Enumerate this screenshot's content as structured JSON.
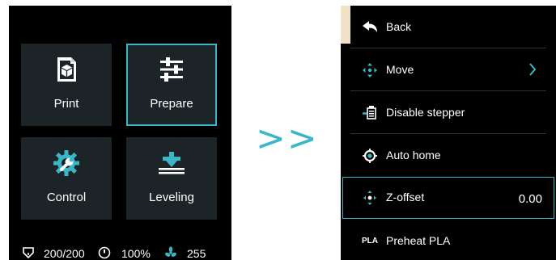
{
  "main_menu": {
    "tiles": [
      {
        "label": "Print",
        "icon": "print-icon"
      },
      {
        "label": "Prepare",
        "icon": "prepare-sliders-icon",
        "selected": true
      },
      {
        "label": "Control",
        "icon": "control-gear-wrench-icon"
      },
      {
        "label": "Leveling",
        "icon": "leveling-icon"
      }
    ],
    "status": {
      "temperature": "200/200",
      "speed": "100%",
      "fan": "255"
    }
  },
  "transition": {
    "arrows": ">>"
  },
  "prepare_menu": {
    "items": [
      {
        "label": "Back",
        "icon": "back-arrow-icon"
      },
      {
        "label": "Move",
        "icon": "move-arrows-icon",
        "has_submenu": true
      },
      {
        "label": "Disable stepper",
        "icon": "stepper-icon"
      },
      {
        "label": "Auto home",
        "icon": "home-target-icon"
      },
      {
        "label": "Z-offset",
        "icon": "z-offset-icon",
        "value": "0.00",
        "selected": true
      },
      {
        "label": "Preheat PLA",
        "icon": "pla-icon",
        "icon_text": "PLA"
      }
    ]
  },
  "colors": {
    "accent": "#3bb6c7",
    "tile_bg": "#1c2428",
    "back_accent": "#f2e1c6",
    "screen_bg": "#000000"
  }
}
